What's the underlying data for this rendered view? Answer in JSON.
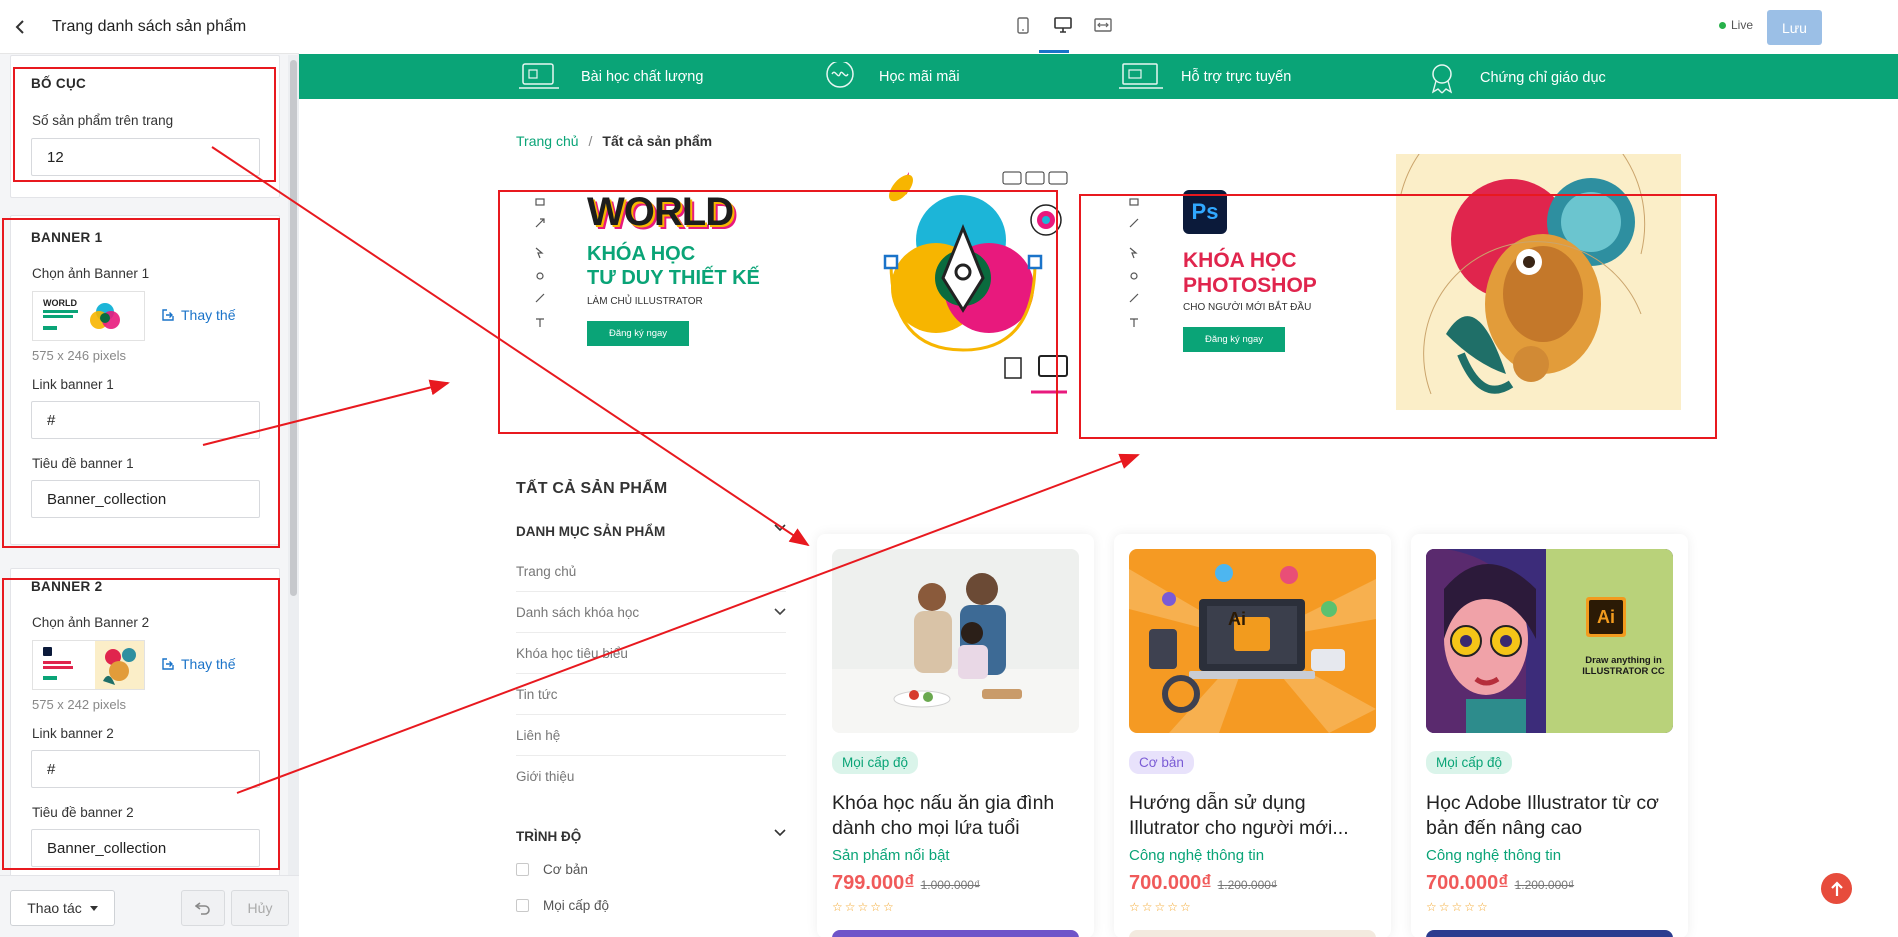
{
  "header": {
    "title": "Trang danh sách sản phẩm",
    "live_label": "Live",
    "save_label": "Lưu"
  },
  "panel": {
    "layout": {
      "title": "BỐ CỤC",
      "per_page_label": "Số sản phẩm trên trang",
      "per_page_value": "12"
    },
    "banner1": {
      "title": "BANNER 1",
      "image_label": "Chọn ảnh Banner 1",
      "replace_label": "Thay thế",
      "size_text": "575 x 246 pixels",
      "link_label": "Link banner 1",
      "link_value": "#",
      "heading_label": "Tiêu đề banner 1",
      "heading_value": "Banner_collection"
    },
    "banner2": {
      "title": "BANNER 2",
      "image_label": "Chọn ảnh Banner 2",
      "replace_label": "Thay thế",
      "size_text": "575 x 242 pixels",
      "link_label": "Link banner 2",
      "link_value": "#",
      "heading_label": "Tiêu đề banner 2",
      "heading_value": "Banner_collection"
    },
    "footer": {
      "actions_label": "Thao tác",
      "cancel_label": "Hủy"
    }
  },
  "features": [
    {
      "label": "Bài học chất lượng",
      "icon": "lesson-icon"
    },
    {
      "label": "Học mãi mãi",
      "icon": "infinite-icon"
    },
    {
      "label": "Hỗ trợ trực tuyến",
      "icon": "support-icon"
    },
    {
      "label": "Chứng chỉ giáo dục",
      "icon": "certificate-icon"
    }
  ],
  "breadcrumb": {
    "home": "Trang chủ",
    "separator": "/",
    "current": "Tất cả sản phẩm"
  },
  "banners": {
    "b1": {
      "word": "WORLD",
      "line1": "KHÓA HỌC",
      "line2": "TƯ DUY THIẾT KẾ",
      "sub": "LÀM CHỦ ILLUSTRATOR",
      "cta": "Đăng ký ngay"
    },
    "b2": {
      "logo": "Ps",
      "line1": "KHÓA HỌC",
      "line2": "PHOTOSHOP",
      "sub": "CHO NGƯỜI MỚI BẮT ĐẦU",
      "cta": "Đăng ký ngay"
    }
  },
  "sidebar": {
    "title": "TẤT CẢ SẢN PHẨM",
    "category_heading": "DANH MỤC SẢN PHẨM",
    "items": [
      "Trang chủ",
      "Danh sách khóa học",
      "Khóa học tiêu biểu",
      "Tin tức",
      "Liên hệ",
      "Giới thiệu"
    ],
    "level_heading": "TRÌNH ĐỘ",
    "levels": [
      "Cơ bản",
      "Mọi cấp độ"
    ]
  },
  "products": [
    {
      "badge": "Mọi cấp độ",
      "title": "Khóa học nấu ăn gia đình dành cho mọi lứa tuổi",
      "category": "Sản phẩm nổi bật",
      "price": "799.000₫",
      "old_price": "1.000.000₫",
      "stars": "☆☆☆☆☆"
    },
    {
      "badge": "Cơ bản",
      "title": "Hướng dẫn sử dụng Illutrator cho người mới...",
      "category": "Công nghệ thông tin",
      "price": "700.000₫",
      "old_price": "1.200.000₫",
      "stars": "☆☆☆☆☆",
      "image_text": "Ai"
    },
    {
      "badge": "Mọi cấp độ",
      "title": "Học Adobe Illustrator từ cơ bản đến nâng cao",
      "category": "Công nghệ thông tin",
      "price": "700.000₫",
      "old_price": "1.200.000₫",
      "stars": "☆☆☆☆☆",
      "image_text": "Ai",
      "image_caption": "Draw anything in ILLUSTRATOR CC"
    }
  ],
  "colors": {
    "brand_green": "#0aa477",
    "annotation_red": "#e8191f",
    "link_blue": "#1a73c9",
    "price_red": "#f05a5a"
  }
}
